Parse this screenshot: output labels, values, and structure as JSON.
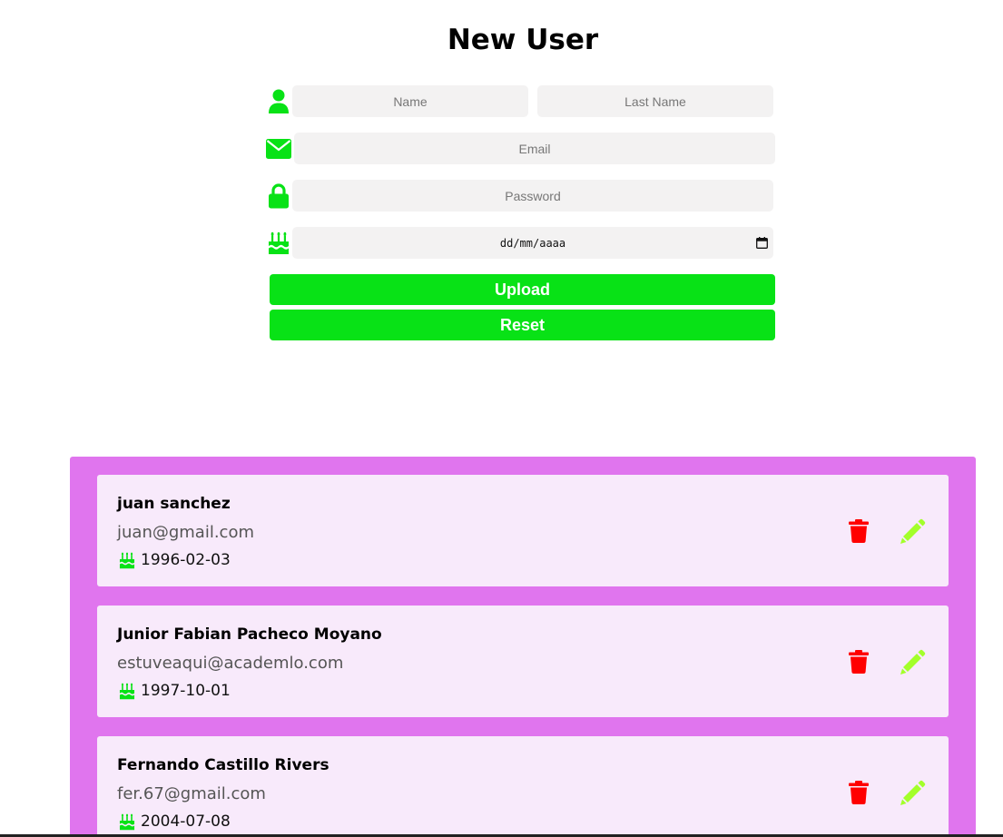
{
  "form": {
    "title": "New User",
    "name_placeholder": "Name",
    "last_name_placeholder": "Last Name",
    "email_placeholder": "Email",
    "password_placeholder": "Password",
    "date_placeholder": "dd/mm/aaaa",
    "upload_label": "Upload",
    "reset_label": "Reset",
    "icons": {
      "name": "user-icon",
      "email": "envelope-icon",
      "password": "lock-icon",
      "birthday": "birthday-cake-icon",
      "date_picker": "calendar-icon"
    }
  },
  "users": [
    {
      "name": "juan sanchez",
      "email": "juan@gmail.com",
      "birthday": "1996-02-03"
    },
    {
      "name": "Junior Fabian Pacheco Moyano",
      "email": "estuveaqui@academlo.com",
      "birthday": "1997-10-01"
    },
    {
      "name": "Fernando Castillo Rivers",
      "email": "fer.67@gmail.com",
      "birthday": "2004-07-08"
    }
  ],
  "card_icons": {
    "birthday": "birthday-cake-icon",
    "delete": "trash-icon",
    "edit": "pencil-icon"
  },
  "colors": {
    "accent_green": "#08e216",
    "panel_purple": "#e075ee",
    "card_background": "#f8eafb",
    "input_background": "#f3f2f2",
    "delete_red": "#ff0000",
    "edit_lime": "#a3ff2a"
  }
}
